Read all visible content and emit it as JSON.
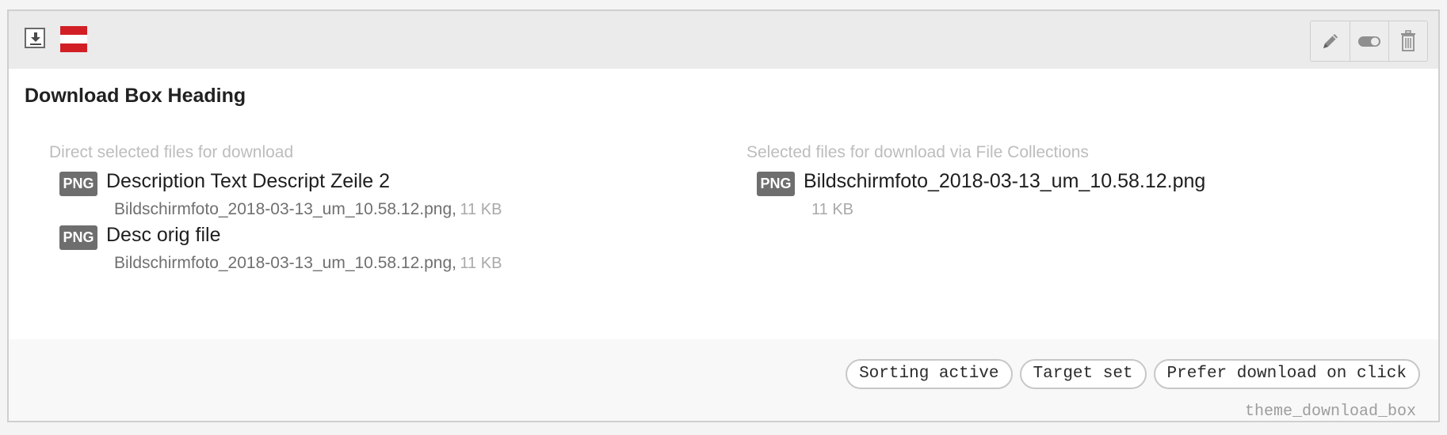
{
  "header": {
    "content_type_icon": "download-box-icon",
    "language_flag": "austria-flag-icon",
    "actions": [
      {
        "name": "edit-button",
        "icon": "pencil-icon"
      },
      {
        "name": "toggle-visibility-button",
        "icon": "toggle-icon"
      },
      {
        "name": "delete-button",
        "icon": "trash-icon"
      }
    ]
  },
  "content": {
    "heading": "Download Box Heading",
    "direct": {
      "title": "Direct selected files for download",
      "files": [
        {
          "type": "PNG",
          "title": "Description Text Descript Zeile 2",
          "filename": "Bildschirmfoto_2018-03-13_um_10.58.12.png,",
          "size": "11 KB"
        },
        {
          "type": "PNG",
          "title": "Desc orig file",
          "filename": "Bildschirmfoto_2018-03-13_um_10.58.12.png,",
          "size": "11 KB"
        }
      ]
    },
    "collections": {
      "title": "Selected files for download via File Collections",
      "files": [
        {
          "type": "PNG",
          "title": "Bildschirmfoto_2018-03-13_um_10.58.12.png",
          "size": "11 KB"
        }
      ]
    }
  },
  "footer": {
    "tags": [
      "Sorting active",
      "Target set",
      "Prefer download on click"
    ],
    "content_type": "theme_download_box"
  },
  "colors": {
    "flag_red": "#d21f26",
    "badge_bg": "#6e6e6e",
    "header_bg": "#ebebeb"
  }
}
